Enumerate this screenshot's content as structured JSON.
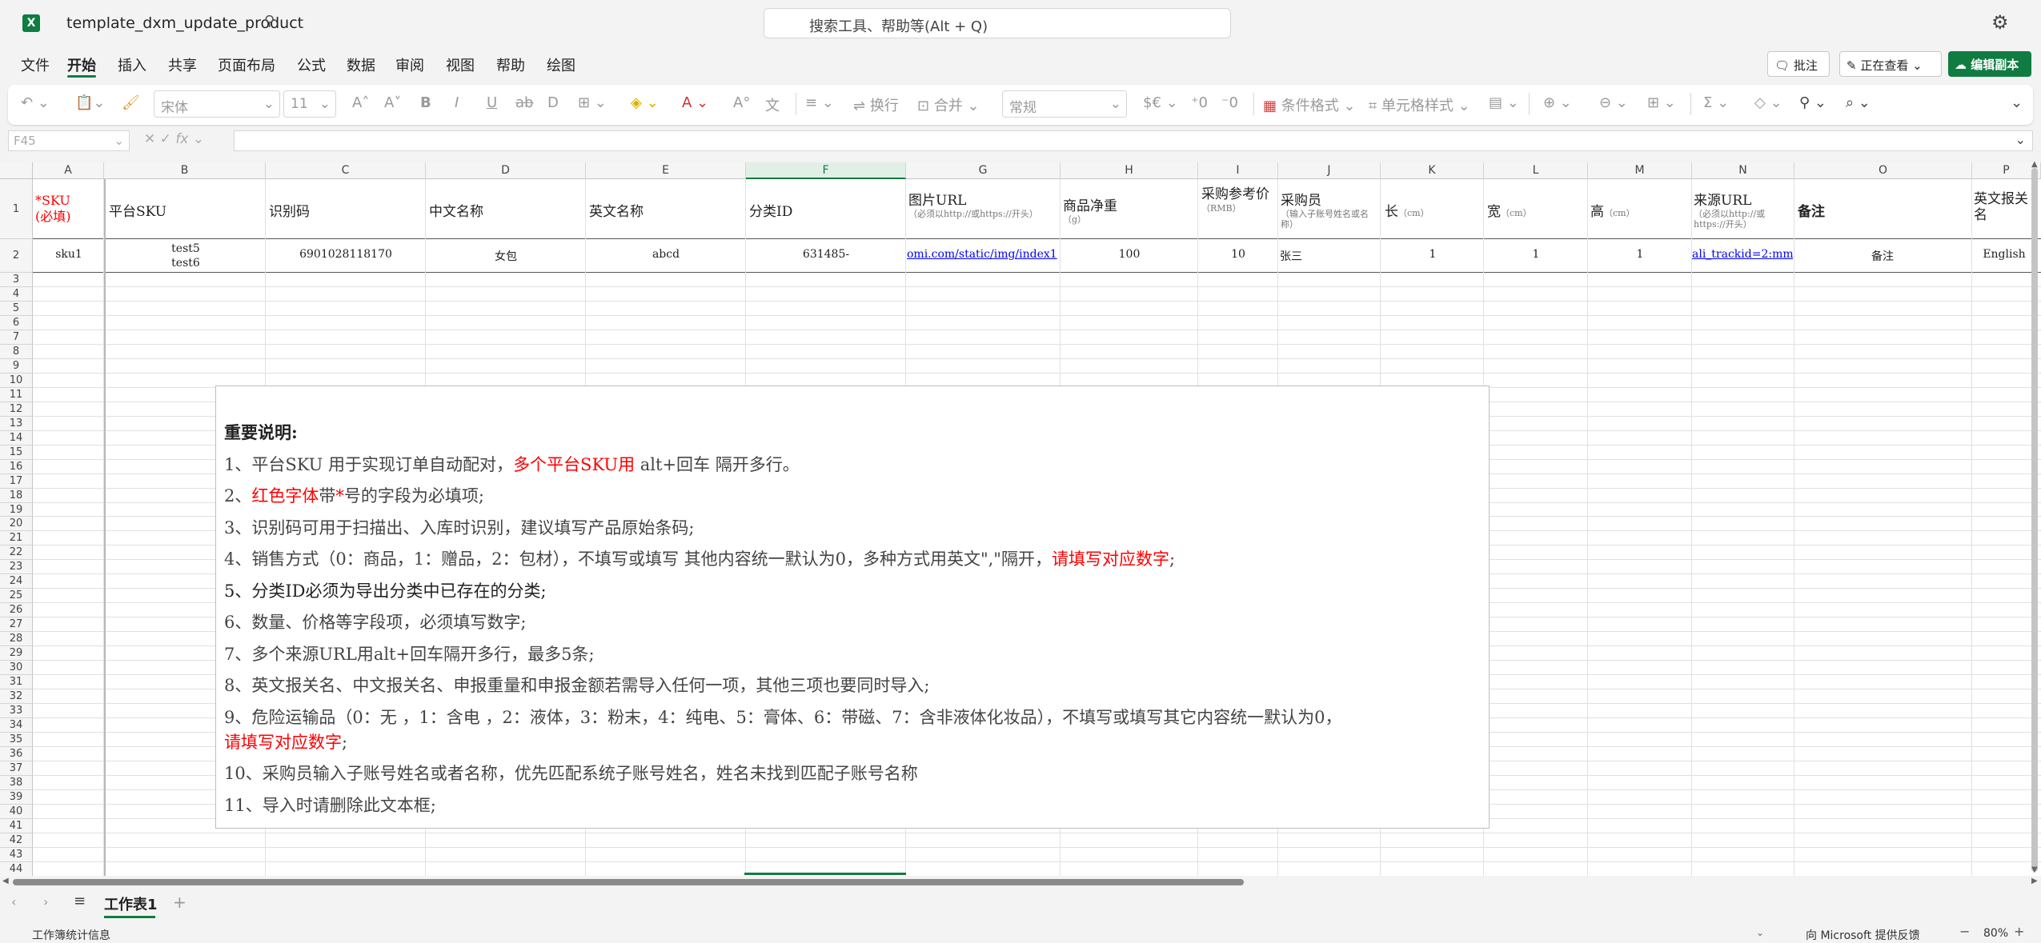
{
  "app": {
    "file_name": "template_dxm_update_product",
    "search_placeholder": "搜索工具、帮助等(Alt + Q)"
  },
  "menu": {
    "items": [
      "文件",
      "开始",
      "插入",
      "共享",
      "页面布局",
      "公式",
      "数据",
      "审阅",
      "视图",
      "帮助",
      "绘图"
    ],
    "active": "开始"
  },
  "actions": {
    "comment": "批注",
    "viewing": "正在查看",
    "edit": "编辑副本"
  },
  "ribbon": {
    "font_name": "宋体",
    "font_size": "11",
    "wrap_text": "换行",
    "merge": "合并",
    "number_format": "常规",
    "conditional_format": "条件格式",
    "cell_styles": "单元格样式"
  },
  "formula_bar": {
    "name_box": "F45",
    "formula": ""
  },
  "columns": [
    "A",
    "B",
    "C",
    "D",
    "E",
    "F",
    "G",
    "H",
    "I",
    "J",
    "K",
    "L",
    "M",
    "N",
    "O",
    "P"
  ],
  "rows": [
    "1",
    "2",
    "3",
    "4",
    "5",
    "6",
    "7",
    "8",
    "9",
    "10",
    "11",
    "12",
    "13",
    "14",
    "15",
    "16",
    "17",
    "18",
    "19",
    "20",
    "21",
    "22",
    "23",
    "24",
    "25",
    "26",
    "27",
    "28",
    "29",
    "30",
    "31",
    "32",
    "33",
    "34",
    "35",
    "36",
    "37",
    "38",
    "39",
    "40",
    "41",
    "42",
    "43",
    "44"
  ],
  "headers": {
    "a_main": "*SKU",
    "a_sub": "(必填)",
    "b": "平台SKU",
    "c": "识别码",
    "d": "中文名称",
    "e": "英文名称",
    "f": "分类ID",
    "g_main": "图片URL",
    "g_sub": "（必须以http://或https://开头）",
    "h_main": "商品净重",
    "h_sub": "（g）",
    "i_main": "采购参考价",
    "i_sub": "（RMB）",
    "j_main": "采购员",
    "j_sub": "（输入子账号姓名或名称）",
    "k_main": "长",
    "k_sub": "（cm）",
    "l_main": "宽",
    "l_sub": "（cm）",
    "m_main": "高",
    "m_sub": "（cm）",
    "n_main": "来源URL",
    "n_sub": "（必须以http://或https://开头）",
    "o": "备注",
    "p": "英文报关名"
  },
  "row2": {
    "a": "sku1",
    "b1": "test5",
    "b2": "test6",
    "c": "6901028118170",
    "d": "女包",
    "e": "abcd",
    "f": "631485-",
    "g": "omi.com/static/img/index1",
    "h": "100",
    "i": "10",
    "j": "张三",
    "k": "1",
    "l": "1",
    "m": "1",
    "n": "ali_trackid=2:mm_",
    "o": "备注",
    "p": "English"
  },
  "notes": {
    "title": "重要说明:",
    "l1a": "1、平台SKU 用于实现订单自动配对，",
    "l1b": "多个平台SKU用",
    "l1c": " alt+回车 隔开多行。",
    "l2a": "2、",
    "l2b": "红色字体",
    "l2c": "带",
    "l2d": "*",
    "l2e": "号的字段为必填项;",
    "l3": "3、识别码可用于扫描出、入库时识别，建议填写产品原始条码;",
    "l4a": "4、销售方式（0：商品，1：赠品，2：包材），不填写或填写 其他内容统一默认为0，多种方式用英文\",\"隔开，",
    "l4b": "请填写对应数字",
    "l4c": ";",
    "l5": "5、分类ID必须为导出分类中已存在的分类;",
    "l6": "6、数量、价格等字段项，必须填写数字;",
    "l7": "7、多个来源URL用alt+回车隔开多行，最多5条;",
    "l8": "8、英文报关名、中文报关名、申报重量和申报金额若需导入任何一项，其他三项也要同时导入;",
    "l9a": "9、危险运输品（0：无 ，1：含电 ，2：液体，3：粉末，4：纯电、5：膏体、6：带磁、7：含非液体化妆品），不填写或填写其它内容统一默认为0，",
    "l9b": "请填写对应数字",
    "l9c": ";",
    "l10": "10、采购员输入子账号姓名或者名称，优先匹配系统子账号姓名，姓名未找到匹配子账号名称",
    "l11": "11、导入时请删除此文本框;"
  },
  "sheet": {
    "tab": "工作表1"
  },
  "status": {
    "left": "工作簿统计信息",
    "feedback": "向 Microsoft 提供反馈",
    "zoom": "80%"
  },
  "colors": {
    "accent": "#107c41",
    "required_red": "#ff0000",
    "link_blue": "#0000ee"
  }
}
